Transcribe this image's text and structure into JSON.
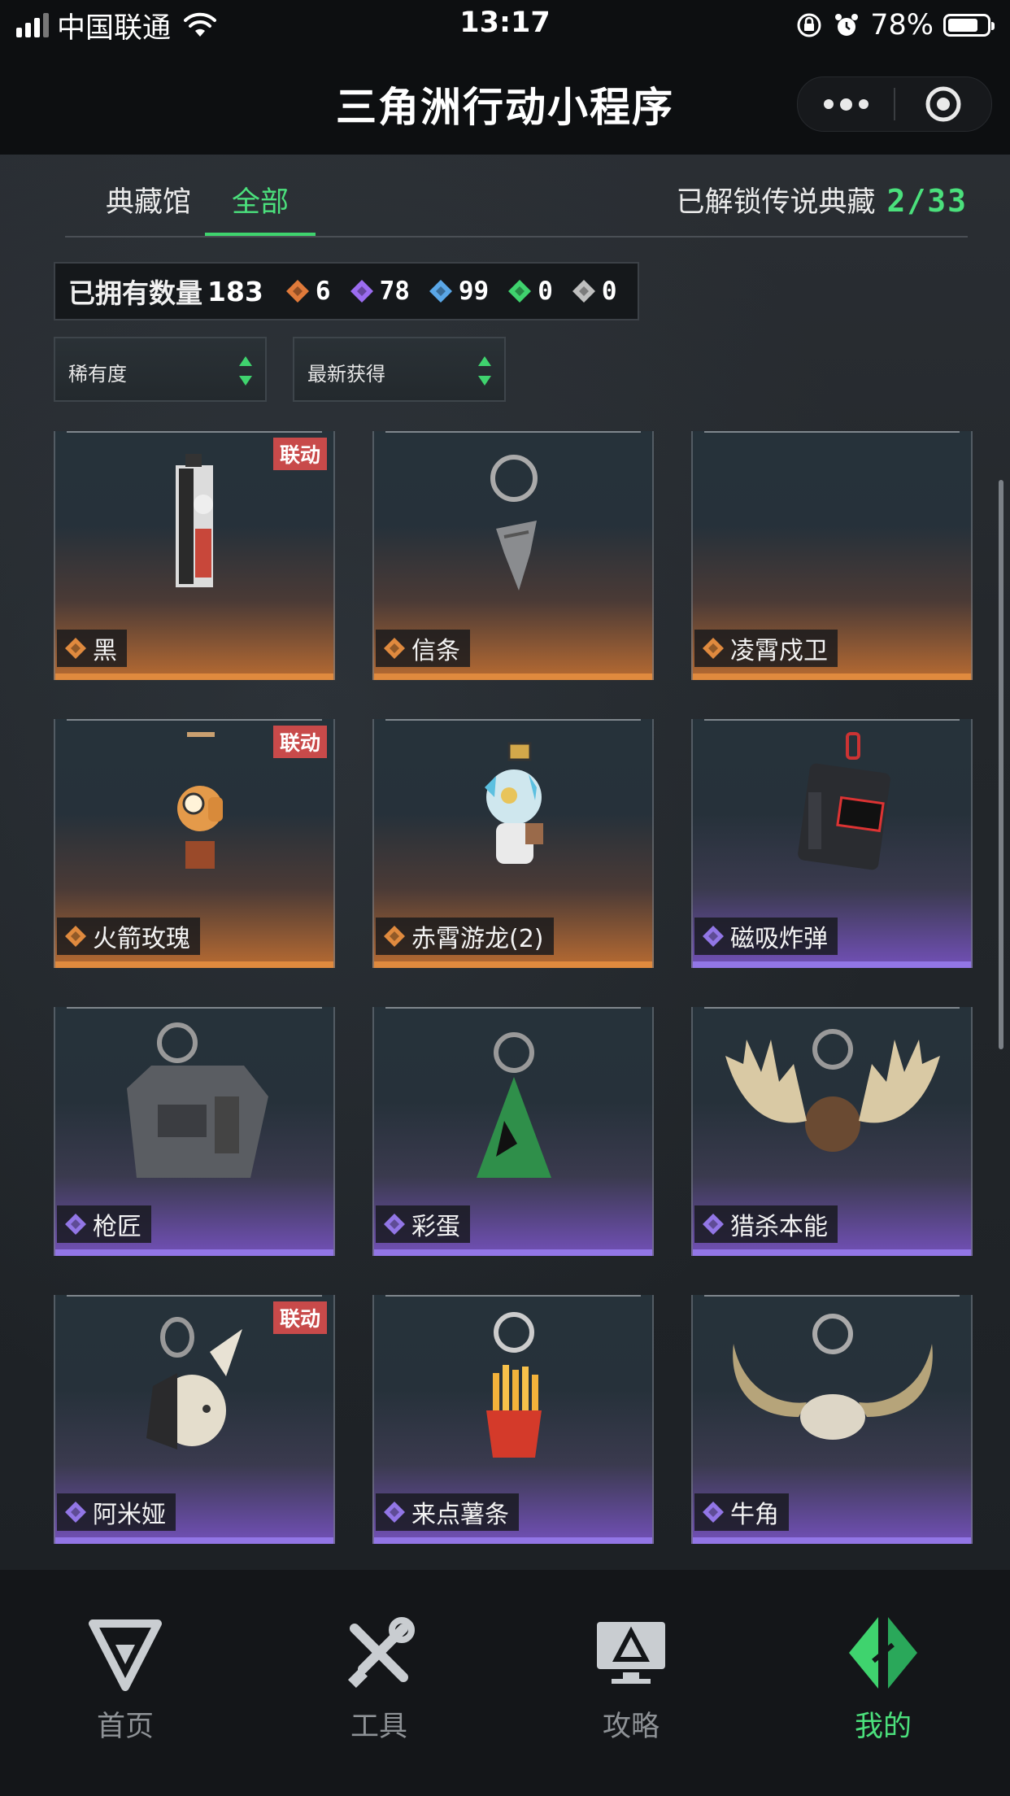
{
  "status_bar": {
    "carrier": "中国联通",
    "time": "13:17",
    "battery": "78%",
    "battery_level": 0.78
  },
  "title_bar": {
    "title": "三角洲行动小程序",
    "more_icon": "more-dots-icon",
    "close_icon": "target-close-icon"
  },
  "tabs": [
    {
      "label": "典藏馆"
    },
    {
      "label": "全部"
    }
  ],
  "unlocked": {
    "label": "已解锁传说典藏",
    "count": "2/33"
  },
  "owned": {
    "label": "已拥有数量",
    "total": "183",
    "rarities": [
      {
        "count": "6",
        "color": "#e07a3a"
      },
      {
        "count": "78",
        "color": "#9b6cf0"
      },
      {
        "count": "99",
        "color": "#5aa7e8"
      },
      {
        "count": "0",
        "color": "#3fd36e"
      },
      {
        "count": "0",
        "color": "#bfbfbf"
      }
    ]
  },
  "filters": {
    "rarity": "稀有度",
    "sort": "最新获得"
  },
  "colors": {
    "accent": "#4be07c",
    "legendary": "#e08a3e",
    "epic": "#9276e6",
    "collab_tag": "#c84a4a"
  },
  "items": [
    {
      "name": "黑",
      "rarity": "orange",
      "tag": "联动",
      "icon": "collab-card-icon"
    },
    {
      "name": "信条",
      "rarity": "orange",
      "tag": "",
      "icon": "metal-keychain-icon"
    },
    {
      "name": "凌霄戍卫",
      "rarity": "orange",
      "tag": "",
      "icon": ""
    },
    {
      "name": "火箭玫瑰",
      "rarity": "orange",
      "tag": "联动",
      "icon": "rocket-rose-icon"
    },
    {
      "name": "赤霄游龙(2)",
      "rarity": "orange",
      "tag": "",
      "icon": "dragon-figure-icon"
    },
    {
      "name": "磁吸炸弹",
      "rarity": "purple",
      "tag": "",
      "icon": "bomb-timer-icon"
    },
    {
      "name": "枪匠",
      "rarity": "purple",
      "tag": "",
      "icon": "gun-case-icon"
    },
    {
      "name": "彩蛋",
      "rarity": "purple",
      "tag": "",
      "icon": "green-egg-icon"
    },
    {
      "name": "猎杀本能",
      "rarity": "purple",
      "tag": "",
      "icon": "antlers-icon"
    },
    {
      "name": "阿米娅",
      "rarity": "purple",
      "tag": "联动",
      "icon": "bunny-figure-icon"
    },
    {
      "name": "来点薯条",
      "rarity": "purple",
      "tag": "",
      "icon": "fries-icon"
    },
    {
      "name": "牛角",
      "rarity": "purple",
      "tag": "",
      "icon": "bull-horns-icon"
    }
  ],
  "bottom_nav": [
    {
      "label": "首页",
      "icon": "home-logo-icon",
      "active": false
    },
    {
      "label": "工具",
      "icon": "tools-icon",
      "active": false
    },
    {
      "label": "攻略",
      "icon": "guide-monitor-icon",
      "active": false
    },
    {
      "label": "我的",
      "icon": "profile-logo-icon",
      "active": true
    }
  ]
}
